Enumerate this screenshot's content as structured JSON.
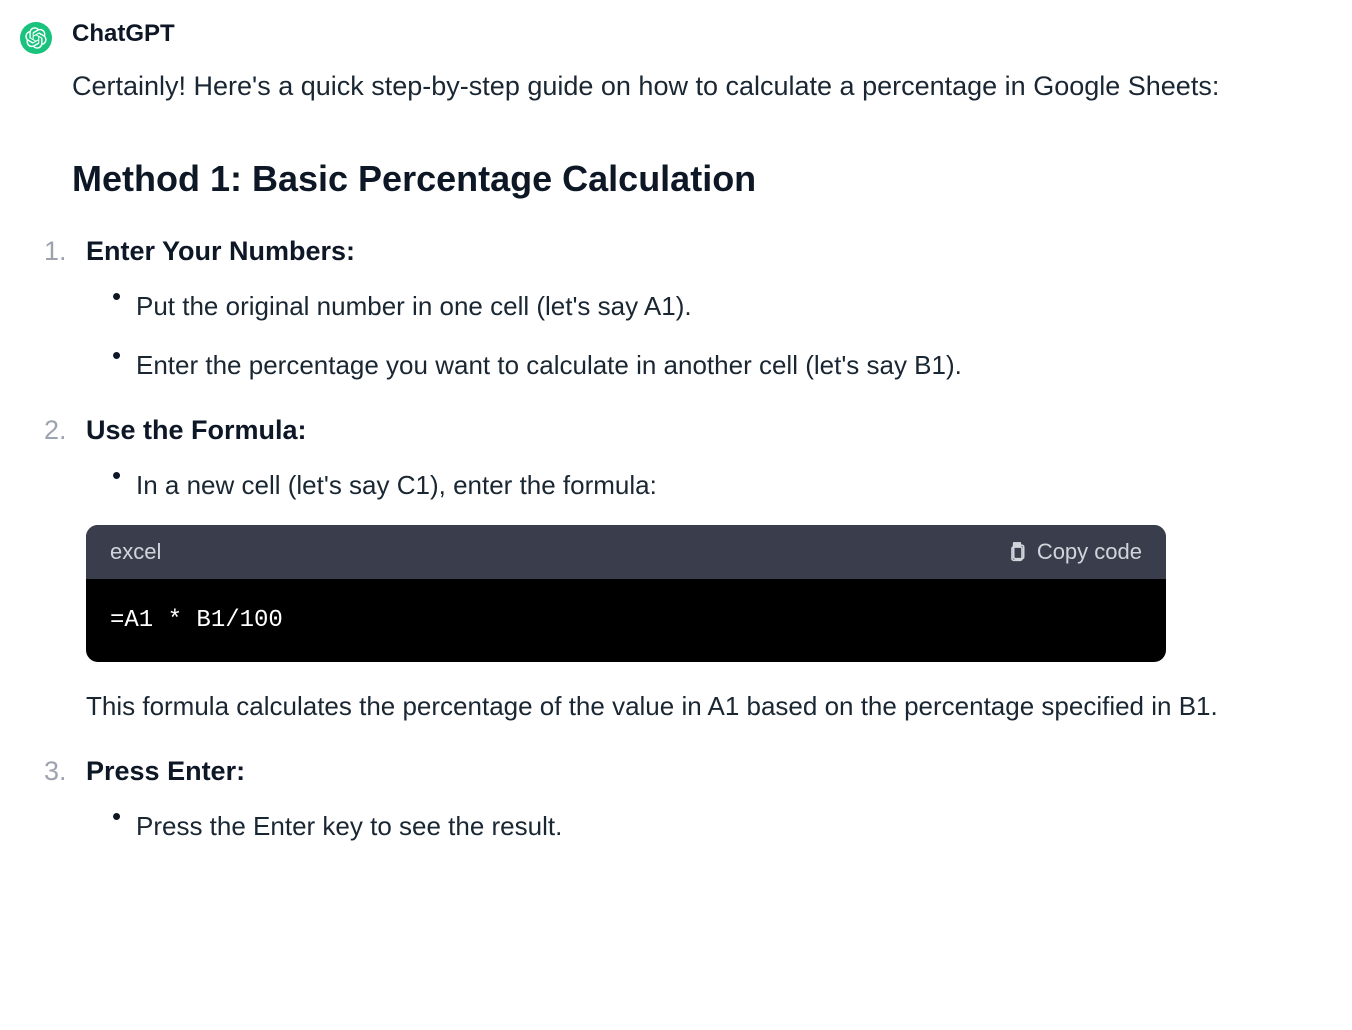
{
  "author": "ChatGPT",
  "intro": "Certainly! Here's a quick step-by-step guide on how to calculate a percentage in Google Sheets:",
  "method_heading": "Method 1: Basic Percentage Calculation",
  "steps": [
    {
      "title": "Enter Your Numbers:",
      "bullets": [
        "Put the original number in one cell (let's say A1).",
        "Enter the percentage you want to calculate in another cell (let's say B1)."
      ]
    },
    {
      "title": "Use the Formula:",
      "bullets": [
        "In a new cell (let's say C1), enter the formula:"
      ],
      "code": {
        "lang": "excel",
        "copy_label": "Copy code",
        "content": "=A1 * B1/100"
      },
      "explanation": "This formula calculates the percentage of the value in A1 based on the percentage specified in B1."
    },
    {
      "title": "Press Enter:",
      "bullets": [
        "Press the Enter key to see the result."
      ]
    }
  ]
}
